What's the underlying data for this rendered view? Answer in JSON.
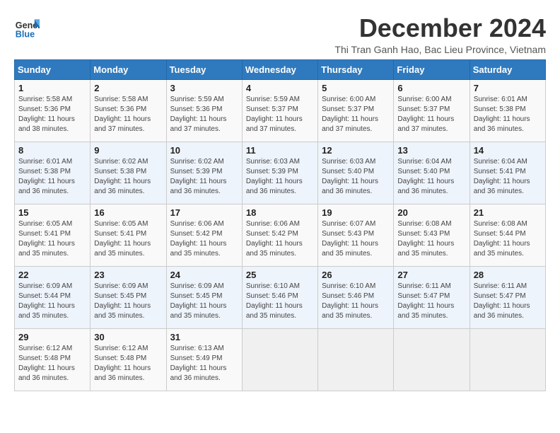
{
  "header": {
    "logo_line1": "General",
    "logo_line2": "Blue",
    "month_title": "December 2024",
    "subtitle": "Thi Tran Ganh Hao, Bac Lieu Province, Vietnam"
  },
  "days_of_week": [
    "Sunday",
    "Monday",
    "Tuesday",
    "Wednesday",
    "Thursday",
    "Friday",
    "Saturday"
  ],
  "weeks": [
    [
      {
        "day": "1",
        "info": "Sunrise: 5:58 AM\nSunset: 5:36 PM\nDaylight: 11 hours\nand 38 minutes."
      },
      {
        "day": "2",
        "info": "Sunrise: 5:58 AM\nSunset: 5:36 PM\nDaylight: 11 hours\nand 37 minutes."
      },
      {
        "day": "3",
        "info": "Sunrise: 5:59 AM\nSunset: 5:36 PM\nDaylight: 11 hours\nand 37 minutes."
      },
      {
        "day": "4",
        "info": "Sunrise: 5:59 AM\nSunset: 5:37 PM\nDaylight: 11 hours\nand 37 minutes."
      },
      {
        "day": "5",
        "info": "Sunrise: 6:00 AM\nSunset: 5:37 PM\nDaylight: 11 hours\nand 37 minutes."
      },
      {
        "day": "6",
        "info": "Sunrise: 6:00 AM\nSunset: 5:37 PM\nDaylight: 11 hours\nand 37 minutes."
      },
      {
        "day": "7",
        "info": "Sunrise: 6:01 AM\nSunset: 5:38 PM\nDaylight: 11 hours\nand 36 minutes."
      }
    ],
    [
      {
        "day": "8",
        "info": "Sunrise: 6:01 AM\nSunset: 5:38 PM\nDaylight: 11 hours\nand 36 minutes."
      },
      {
        "day": "9",
        "info": "Sunrise: 6:02 AM\nSunset: 5:38 PM\nDaylight: 11 hours\nand 36 minutes."
      },
      {
        "day": "10",
        "info": "Sunrise: 6:02 AM\nSunset: 5:39 PM\nDaylight: 11 hours\nand 36 minutes."
      },
      {
        "day": "11",
        "info": "Sunrise: 6:03 AM\nSunset: 5:39 PM\nDaylight: 11 hours\nand 36 minutes."
      },
      {
        "day": "12",
        "info": "Sunrise: 6:03 AM\nSunset: 5:40 PM\nDaylight: 11 hours\nand 36 minutes."
      },
      {
        "day": "13",
        "info": "Sunrise: 6:04 AM\nSunset: 5:40 PM\nDaylight: 11 hours\nand 36 minutes."
      },
      {
        "day": "14",
        "info": "Sunrise: 6:04 AM\nSunset: 5:41 PM\nDaylight: 11 hours\nand 36 minutes."
      }
    ],
    [
      {
        "day": "15",
        "info": "Sunrise: 6:05 AM\nSunset: 5:41 PM\nDaylight: 11 hours\nand 35 minutes."
      },
      {
        "day": "16",
        "info": "Sunrise: 6:05 AM\nSunset: 5:41 PM\nDaylight: 11 hours\nand 35 minutes."
      },
      {
        "day": "17",
        "info": "Sunrise: 6:06 AM\nSunset: 5:42 PM\nDaylight: 11 hours\nand 35 minutes."
      },
      {
        "day": "18",
        "info": "Sunrise: 6:06 AM\nSunset: 5:42 PM\nDaylight: 11 hours\nand 35 minutes."
      },
      {
        "day": "19",
        "info": "Sunrise: 6:07 AM\nSunset: 5:43 PM\nDaylight: 11 hours\nand 35 minutes."
      },
      {
        "day": "20",
        "info": "Sunrise: 6:08 AM\nSunset: 5:43 PM\nDaylight: 11 hours\nand 35 minutes."
      },
      {
        "day": "21",
        "info": "Sunrise: 6:08 AM\nSunset: 5:44 PM\nDaylight: 11 hours\nand 35 minutes."
      }
    ],
    [
      {
        "day": "22",
        "info": "Sunrise: 6:09 AM\nSunset: 5:44 PM\nDaylight: 11 hours\nand 35 minutes."
      },
      {
        "day": "23",
        "info": "Sunrise: 6:09 AM\nSunset: 5:45 PM\nDaylight: 11 hours\nand 35 minutes."
      },
      {
        "day": "24",
        "info": "Sunrise: 6:09 AM\nSunset: 5:45 PM\nDaylight: 11 hours\nand 35 minutes."
      },
      {
        "day": "25",
        "info": "Sunrise: 6:10 AM\nSunset: 5:46 PM\nDaylight: 11 hours\nand 35 minutes."
      },
      {
        "day": "26",
        "info": "Sunrise: 6:10 AM\nSunset: 5:46 PM\nDaylight: 11 hours\nand 35 minutes."
      },
      {
        "day": "27",
        "info": "Sunrise: 6:11 AM\nSunset: 5:47 PM\nDaylight: 11 hours\nand 35 minutes."
      },
      {
        "day": "28",
        "info": "Sunrise: 6:11 AM\nSunset: 5:47 PM\nDaylight: 11 hours\nand 36 minutes."
      }
    ],
    [
      {
        "day": "29",
        "info": "Sunrise: 6:12 AM\nSunset: 5:48 PM\nDaylight: 11 hours\nand 36 minutes."
      },
      {
        "day": "30",
        "info": "Sunrise: 6:12 AM\nSunset: 5:48 PM\nDaylight: 11 hours\nand 36 minutes."
      },
      {
        "day": "31",
        "info": "Sunrise: 6:13 AM\nSunset: 5:49 PM\nDaylight: 11 hours\nand 36 minutes."
      },
      {
        "day": "",
        "info": ""
      },
      {
        "day": "",
        "info": ""
      },
      {
        "day": "",
        "info": ""
      },
      {
        "day": "",
        "info": ""
      }
    ]
  ]
}
